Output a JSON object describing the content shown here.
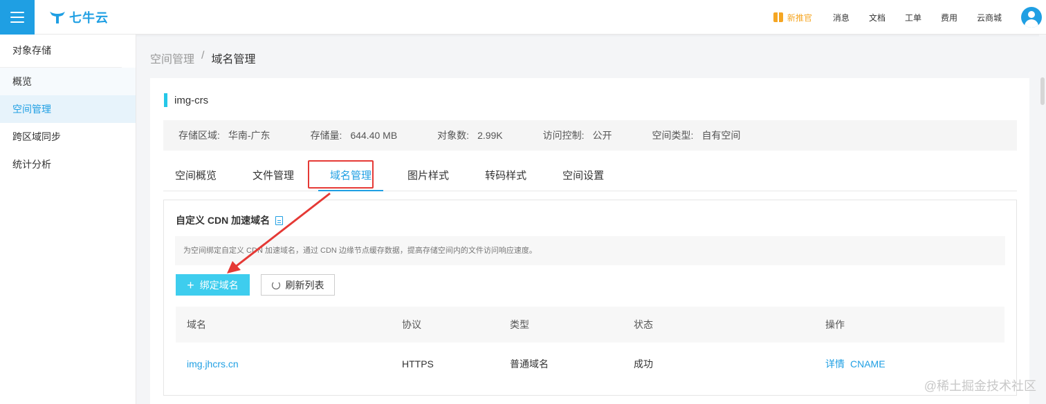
{
  "header": {
    "logo_text": "七牛云",
    "nav": [
      "消息",
      "文档",
      "工单",
      "费用",
      "云商城"
    ],
    "promo_label": "新推官"
  },
  "sidebar": {
    "title": "对象存储",
    "items": [
      {
        "label": "概览"
      },
      {
        "label": "空间管理"
      },
      {
        "label": "跨区域同步"
      },
      {
        "label": "统计分析"
      }
    ]
  },
  "breadcrumb": {
    "parent": "空间管理",
    "separator": "/",
    "current": "域名管理"
  },
  "bucket": {
    "name": "img-crs",
    "info": [
      {
        "key": "存储区域:",
        "value": "华南-广东"
      },
      {
        "key": "存储量:",
        "value": "644.40 MB"
      },
      {
        "key": "对象数:",
        "value": "2.99K"
      },
      {
        "key": "访问控制:",
        "value": "公开"
      },
      {
        "key": "空间类型:",
        "value": "自有空间"
      }
    ]
  },
  "tabs": [
    "空间概览",
    "文件管理",
    "域名管理",
    "图片样式",
    "转码样式",
    "空间设置"
  ],
  "cdn": {
    "title": "自定义 CDN 加速域名",
    "description": "为空间绑定自定义 CDN 加速域名，通过 CDN 边缘节点缓存数据，提高存储空间内的文件访问响应速度。",
    "bind_button": "绑定域名",
    "refresh_button": "刷新列表"
  },
  "table": {
    "headers": [
      "域名",
      "协议",
      "类型",
      "状态",
      "操作"
    ],
    "rows": [
      {
        "domain": "img.jhcrs.cn",
        "protocol": "HTTPS",
        "type": "普通域名",
        "status": "成功",
        "op_detail": "详情",
        "op_cname": "CNAME"
      }
    ]
  },
  "watermark": "@稀土掘金技术社区",
  "colors": {
    "accent": "#1f9fe3",
    "bind_button": "#3ecdee",
    "annotation": "#e53935",
    "promo": "#f5a623"
  }
}
